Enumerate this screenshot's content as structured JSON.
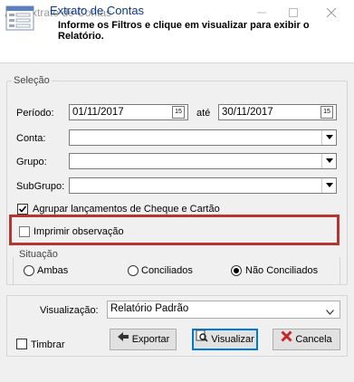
{
  "window": {
    "title": "Extrato de Contas"
  },
  "header": {
    "title": "Extrato de Contas",
    "subtitle": "Informe os Filtros e clique em visualizar para exibir o Relatório."
  },
  "selecao": {
    "legend": "Seleção",
    "periodo_label": "Período:",
    "data_inicio": "01/11/2017",
    "ate_label": "até",
    "data_fim": "30/11/2017",
    "calendar_icon_text": "15",
    "conta_label": "Conta:",
    "conta_value": "",
    "grupo_label": "Grupo:",
    "grupo_value": "",
    "subgrupo_label": "SubGrupo:",
    "subgrupo_value": "",
    "agrupar_label": "Agrupar lançamentos de Cheque e Cartão",
    "agrupar_checked": true,
    "imprimir_label": "Imprimir observação",
    "imprimir_checked": false
  },
  "situacao": {
    "legend": "Situação",
    "options": [
      "Ambas",
      "Conciliados",
      "Não Conciliados"
    ],
    "selected": "Não Conciliados"
  },
  "visualizacao": {
    "label": "Visualização:",
    "value": "Relatório Padrão"
  },
  "timbrar": {
    "label": "Timbrar",
    "checked": false
  },
  "buttons": {
    "exportar": "Exportar",
    "visualizar": "Visualizar",
    "cancelar": "Cancela"
  },
  "colors": {
    "highlight": "#b53630",
    "header_title": "#0b3a8c",
    "app_icon": "#c62828"
  }
}
